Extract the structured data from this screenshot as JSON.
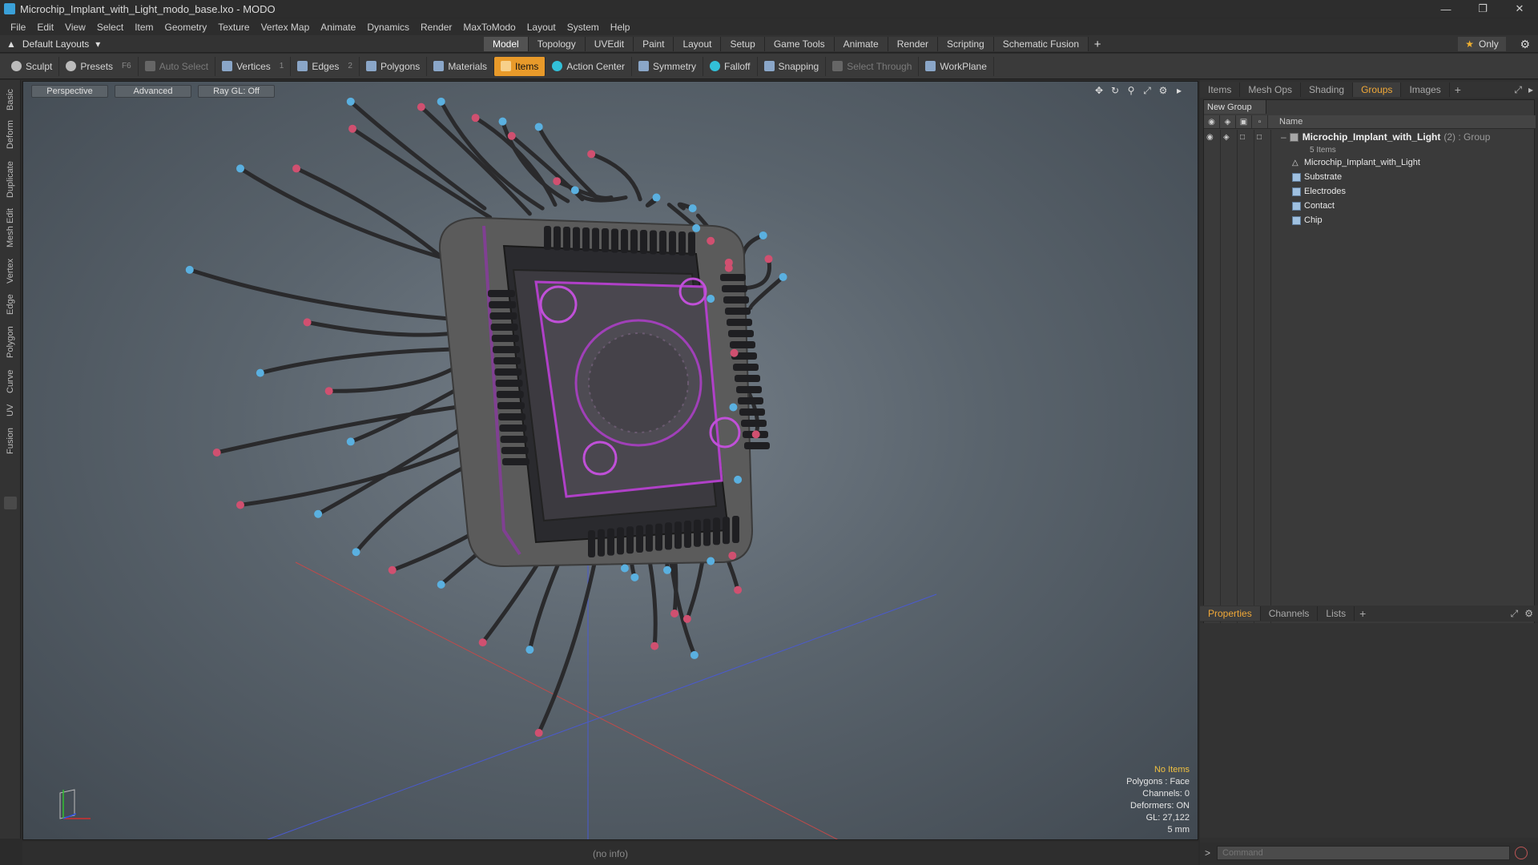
{
  "window": {
    "title": "Microchip_Implant_with_Light_modo_base.lxo - MODO",
    "minimize": "—",
    "restore": "❐",
    "close": "✕"
  },
  "menu": [
    "File",
    "Edit",
    "View",
    "Select",
    "Item",
    "Geometry",
    "Texture",
    "Vertex Map",
    "Animate",
    "Dynamics",
    "Render",
    "MaxToModo",
    "Layout",
    "System",
    "Help"
  ],
  "layout_bar": {
    "layouts_label": "Default Layouts",
    "tabs": [
      "Model",
      "Topology",
      "UVEdit",
      "Paint",
      "Layout",
      "Setup",
      "Game Tools",
      "Animate",
      "Render",
      "Scripting",
      "Schematic Fusion"
    ],
    "active_tab": "Model",
    "add": "+",
    "only_label": "Only"
  },
  "toolbar": {
    "sculpt": "Sculpt",
    "presets": "Presets",
    "presets_key": "F6",
    "auto_select": "Auto Select",
    "vertices": "Vertices",
    "vertices_key": "1",
    "edges": "Edges",
    "edges_key": "2",
    "polygons": "Polygons",
    "materials": "Materials",
    "items": "Items",
    "action_center": "Action Center",
    "symmetry": "Symmetry",
    "falloff": "Falloff",
    "snapping": "Snapping",
    "select_through": "Select Through",
    "workplane": "WorkPlane"
  },
  "left_tabs": [
    "Basic",
    "Deform",
    "Duplicate",
    "Mesh Edit",
    "Vertex",
    "Edge",
    "Polygon",
    "Curve",
    "UV",
    "Fusion"
  ],
  "viewport": {
    "perspective": "Perspective",
    "advanced": "Advanced",
    "raygl": "Ray GL: Off",
    "info": {
      "no_items": "No Items",
      "polygons": "Polygons : Face",
      "channels": "Channels: 0",
      "deformers": "Deformers: ON",
      "gl": "GL: 27,122",
      "unit": "5 mm"
    }
  },
  "status": "(no info)",
  "right_panel": {
    "tabs": [
      "Items",
      "Mesh Ops",
      "Shading",
      "Groups",
      "Images"
    ],
    "active_tab": "Groups",
    "add": "+",
    "new_group": "New Group",
    "name_header": "Name",
    "root": {
      "name": "Microchip_Implant_with_Light",
      "suffix": "(2) : Group",
      "count": "5 Items"
    },
    "children": [
      "Microchip_Implant_with_Light",
      "Substrate",
      "Electrodes",
      "Contact",
      "Chip"
    ]
  },
  "props_panel": {
    "tabs": [
      "Properties",
      "Channels",
      "Lists"
    ],
    "active_tab": "Properties",
    "add": "+"
  },
  "command": {
    "prompt": ">",
    "placeholder": "Command"
  }
}
